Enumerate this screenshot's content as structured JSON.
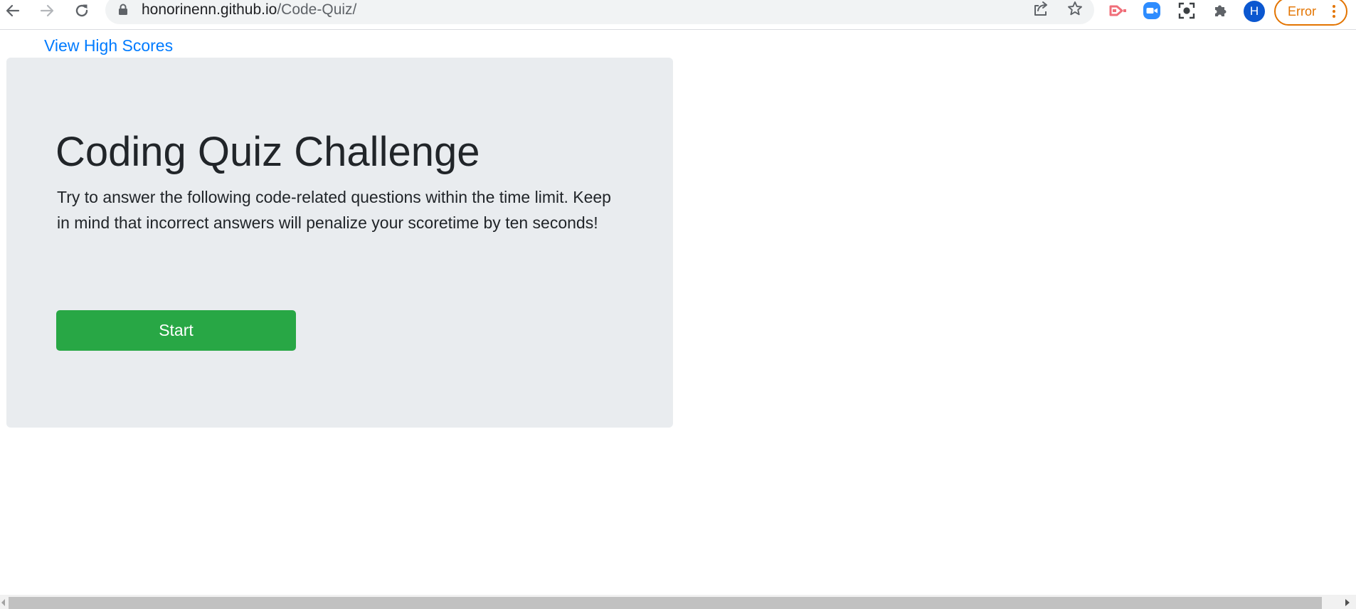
{
  "browser": {
    "url_host": "honorinenn.github.io",
    "url_path": "/Code-Quiz/",
    "profile_initial": "H",
    "error_label": "Error",
    "icons": {
      "back": "back-arrow-icon",
      "forward": "forward-arrow-icon",
      "reload": "reload-icon",
      "lock": "lock-icon",
      "share": "share-icon",
      "bookmark": "star-icon",
      "ext1": "video-cast-extension-icon",
      "ext2": "zoom-extension-icon",
      "ext3": "screenshot-extension-icon",
      "extensions": "puzzle-icon",
      "menu": "kebab-menu-icon"
    },
    "colors": {
      "profile": "#0b57d0",
      "error": "#e37400"
    }
  },
  "page": {
    "high_scores_link": "View High Scores",
    "title": "Coding Quiz Challenge",
    "description": "Try to answer the following code-related questions within the time limit. Keep in mind that incorrect answers will penalize your scoretime by ten seconds!",
    "start_button": "Start",
    "colors": {
      "link": "#007bff",
      "jumbotron_bg": "#e9ecef",
      "start_button_bg": "#28a745"
    }
  }
}
